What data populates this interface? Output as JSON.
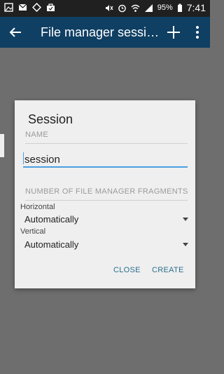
{
  "status_bar": {
    "battery": "95%",
    "time": "7:41"
  },
  "app_bar": {
    "title": "File manager sessio...",
    "icons": [
      "back-arrow-icon",
      "add-icon",
      "more-vert-icon"
    ]
  },
  "dialog": {
    "title": "Session",
    "name_section": "NAME",
    "name_value": "session",
    "fragments_section": "NUMBER OF FILE MANAGER FRAGMENTS",
    "horizontal_label": "Horizontal",
    "horizontal_value": "Automatically",
    "vertical_label": "Vertical",
    "vertical_value": "Automatically",
    "close_button": "CLOSE",
    "create_button": "CREATE"
  },
  "colors": {
    "status_bar": "#202020",
    "app_bar": "#0f3f63",
    "scrim": "#6e6e6e",
    "dialog": "#efefef",
    "accent": "#4a9fe0",
    "button_text": "#2a6f8c"
  }
}
